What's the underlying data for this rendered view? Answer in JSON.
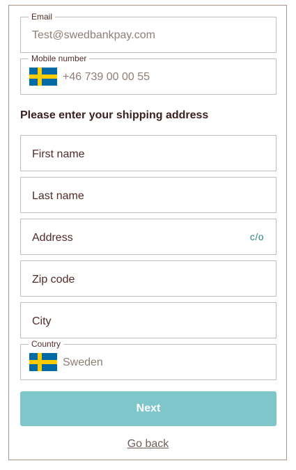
{
  "contact": {
    "email": {
      "label": "Email",
      "value": "Test@swedbankpay.com"
    },
    "mobile": {
      "label": "Mobile number",
      "flag_icon": "sweden-flag-icon",
      "value": "+46 739 00 00 55"
    }
  },
  "shipping": {
    "heading": "Please enter your shipping address",
    "first_name": {
      "placeholder": "First name"
    },
    "last_name": {
      "placeholder": "Last name"
    },
    "address": {
      "placeholder": "Address",
      "co_link": "c/o"
    },
    "zip_code": {
      "placeholder": "Zip code"
    },
    "city": {
      "placeholder": "City"
    },
    "country": {
      "label": "Country",
      "flag_icon": "sweden-flag-icon",
      "value": "Sweden"
    }
  },
  "actions": {
    "next_label": "Next",
    "go_back_label": "Go back"
  },
  "colors": {
    "frame_border": "#a9948c",
    "field_border": "#c5bdba",
    "text": "#512b2b",
    "value_text": "#8f7d77",
    "link": "#2a7f8e",
    "button_bg": "#7fc6cb",
    "button_text": "#ffffff",
    "flag_blue": "#006aa7",
    "flag_yellow": "#fecc00"
  }
}
